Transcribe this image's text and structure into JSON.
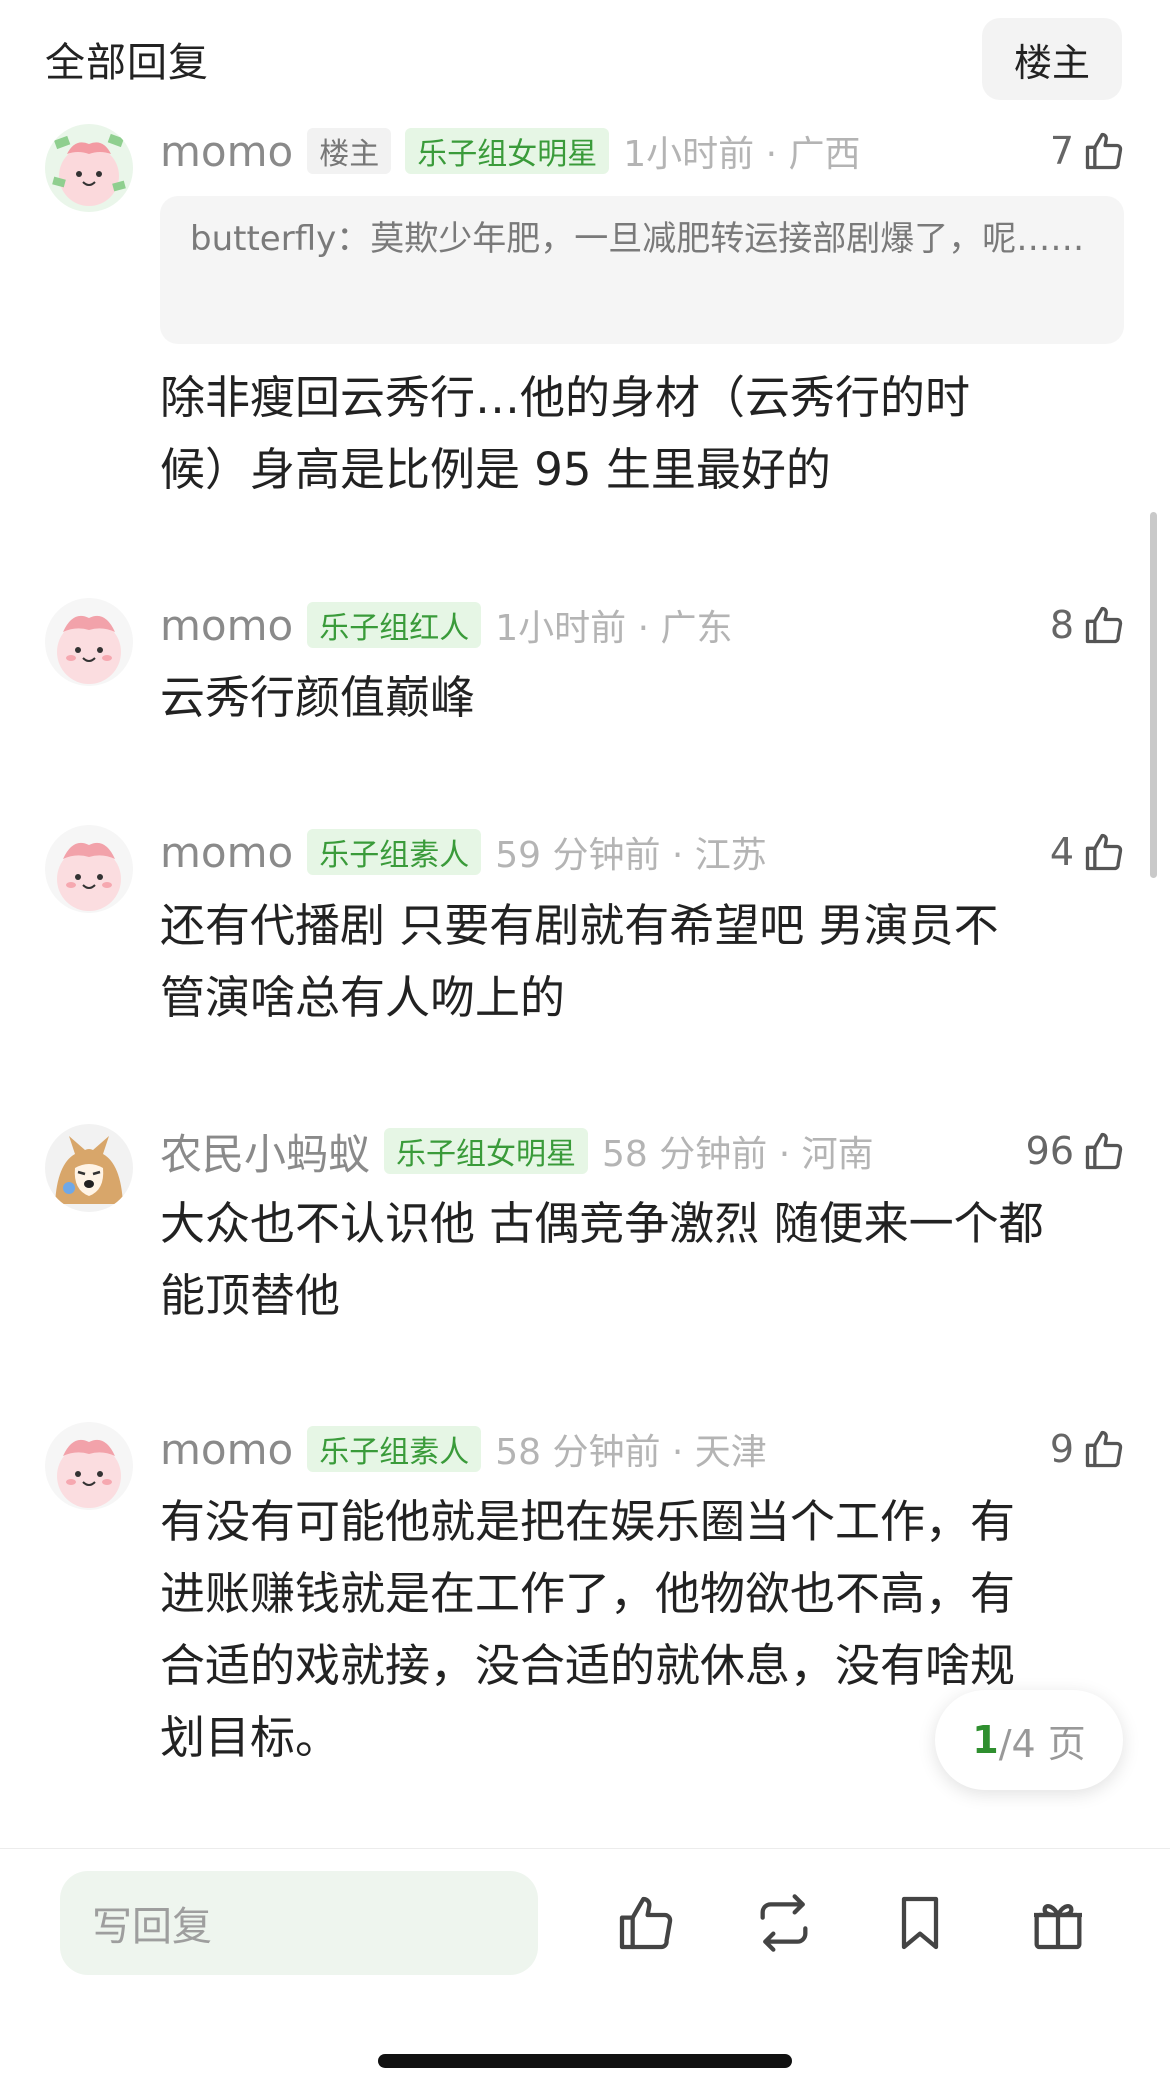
{
  "header": {
    "title": "全部回复",
    "op_filter": "楼主"
  },
  "comments": [
    {
      "username": "momo",
      "badges": [
        "楼主",
        "乐子组女明星"
      ],
      "time": "1小时前 · 广西",
      "likes": "7",
      "quote": "butterfly：莫欺少年肥，一旦减肥转运接部剧爆了，呢……",
      "body_lines": [
        "除非瘦回云秀行…他的身材（云秀行的时",
        "候）身高是比例是 95 生里最好的"
      ]
    },
    {
      "username": "momo",
      "badges": [
        "乐子组红人"
      ],
      "time": "1小时前 · 广东",
      "likes": "8",
      "body_lines": [
        "云秀行颜值巅峰"
      ]
    },
    {
      "username": "momo",
      "badges": [
        "乐子组素人"
      ],
      "time": "59 分钟前 · 江苏",
      "likes": "4",
      "body_lines": [
        "还有代播剧  只要有剧就有希望吧  男演员不",
        "管演啥总有人吻上的"
      ]
    },
    {
      "username": "农民小蚂蚁",
      "badges": [
        "乐子组女明星"
      ],
      "time": "58 分钟前 · 河南",
      "likes": "96",
      "body_lines": [
        "大众也不认识他 古偶竞争激烈 随便来一个都",
        "能顶替他"
      ]
    },
    {
      "username": "momo",
      "badges": [
        "乐子组素人"
      ],
      "time": "58 分钟前 · 天津",
      "likes": "9",
      "body_lines": [
        "有没有可能他就是把在娱乐圈当个工作，有",
        "进账赚钱就是在工作了，他物欲也不高，有",
        "合适的戏就接，没合适的就休息，没有啥规",
        "划目标。"
      ]
    }
  ],
  "pager": {
    "current": "1",
    "total": "/4 页"
  },
  "bottom_bar": {
    "reply_placeholder": "写回复",
    "icons": [
      "like-icon",
      "repost-icon",
      "bookmark-icon",
      "gift-icon"
    ]
  },
  "colors": {
    "accent_green": "#3a9b3a",
    "badge_green_bg": "#e6f6e5",
    "meta_gray": "#8a8a8a"
  }
}
